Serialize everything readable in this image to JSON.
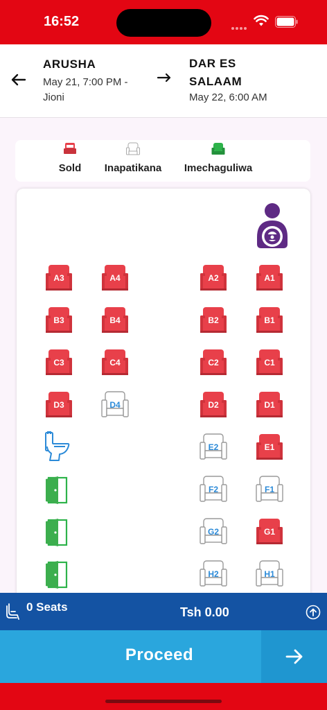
{
  "status_bar": {
    "time": "16:52"
  },
  "trip": {
    "from_city": "ARUSHA",
    "from_date": "May 21, 7:00 PM - Jioni",
    "to_city": "DAR ES SALAAM",
    "to_date": "May 22, 6:00 AM"
  },
  "legend": {
    "sold_label": "Sold",
    "available_label": "Inapatikana",
    "selected_label": "Imechaguliwa"
  },
  "colors": {
    "brand_red": "#e30613",
    "sold": "#e8404a",
    "available_outline": "#9a9a9a",
    "available_text": "#2b8ad8",
    "selected": "#2db34a",
    "driver": "#5e2a84",
    "summary_bar": "#1453a3",
    "proceed": "#2aa6dd"
  },
  "seats": [
    {
      "label": "A3",
      "status": "sold"
    },
    {
      "label": "A4",
      "status": "sold"
    },
    {
      "label": "A2",
      "status": "sold"
    },
    {
      "label": "A1",
      "status": "sold"
    },
    {
      "label": "B3",
      "status": "sold"
    },
    {
      "label": "B4",
      "status": "sold"
    },
    {
      "label": "B2",
      "status": "sold"
    },
    {
      "label": "B1",
      "status": "sold"
    },
    {
      "label": "C3",
      "status": "sold"
    },
    {
      "label": "C4",
      "status": "sold"
    },
    {
      "label": "C2",
      "status": "sold"
    },
    {
      "label": "C1",
      "status": "sold"
    },
    {
      "label": "D3",
      "status": "sold"
    },
    {
      "label": "D4",
      "status": "available"
    },
    {
      "label": "D2",
      "status": "sold"
    },
    {
      "label": "D1",
      "status": "sold"
    },
    {
      "label": "E2",
      "status": "available"
    },
    {
      "label": "E1",
      "status": "sold"
    },
    {
      "label": "F2",
      "status": "available"
    },
    {
      "label": "F1",
      "status": "available"
    },
    {
      "label": "G2",
      "status": "available"
    },
    {
      "label": "G1",
      "status": "sold"
    },
    {
      "label": "H2",
      "status": "available"
    },
    {
      "label": "H1",
      "status": "available"
    }
  ],
  "facilities": [
    {
      "icon": "toilet-icon"
    },
    {
      "icon": "door-icon"
    },
    {
      "icon": "door-icon"
    },
    {
      "icon": "door-icon"
    }
  ],
  "summary": {
    "seats_label": "0 Seats",
    "total_label": "Tsh 0.00"
  },
  "actions": {
    "proceed_label": "Proceed"
  }
}
